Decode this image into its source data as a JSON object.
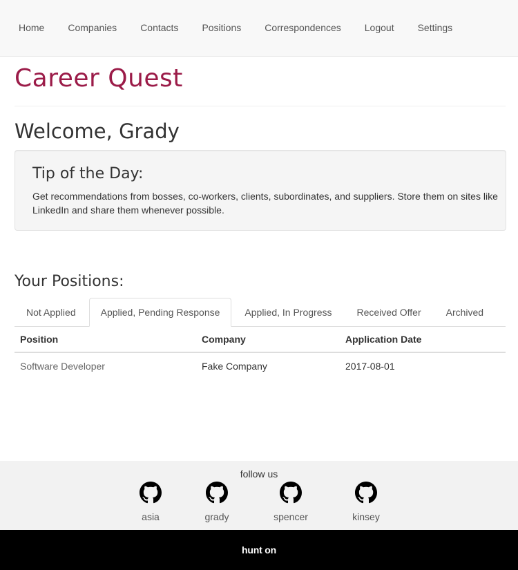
{
  "nav": {
    "items": [
      {
        "label": "Home",
        "id": "home"
      },
      {
        "label": "Companies",
        "id": "companies"
      },
      {
        "label": "Contacts",
        "id": "contacts"
      },
      {
        "label": "Positions",
        "id": "positions"
      },
      {
        "label": "Correspondences",
        "id": "correspondences"
      },
      {
        "label": "Logout",
        "id": "logout"
      },
      {
        "label": "Settings",
        "id": "settings"
      }
    ]
  },
  "brand": {
    "title": "Career Quest",
    "color": "#9b1b48"
  },
  "welcome": {
    "text": "Welcome, Grady"
  },
  "tip": {
    "heading": "Tip of the Day:",
    "text": "Get recommendations from bosses, co-workers, clients, subordinates, and suppliers. Store them on sites like LinkedIn and share them whenever possible."
  },
  "positions": {
    "title": "Your Positions:",
    "tabs": [
      {
        "label": "Not Applied",
        "active": false
      },
      {
        "label": "Applied, Pending Response",
        "active": true
      },
      {
        "label": "Applied, In Progress",
        "active": false
      },
      {
        "label": "Received Offer",
        "active": false
      },
      {
        "label": "Archived",
        "active": false
      }
    ],
    "columns": [
      "Position",
      "Company",
      "Application Date"
    ],
    "rows": [
      {
        "position": "Software Developer",
        "company": "Fake Company",
        "date": "2017-08-01"
      }
    ]
  },
  "footer": {
    "follow": "follow us",
    "developers": [
      {
        "name": "asia",
        "icon": "github-icon"
      },
      {
        "name": "grady",
        "icon": "github-icon"
      },
      {
        "name": "spencer",
        "icon": "github-icon"
      },
      {
        "name": "kinsey",
        "icon": "github-icon"
      }
    ],
    "tagline": "hunt on"
  }
}
